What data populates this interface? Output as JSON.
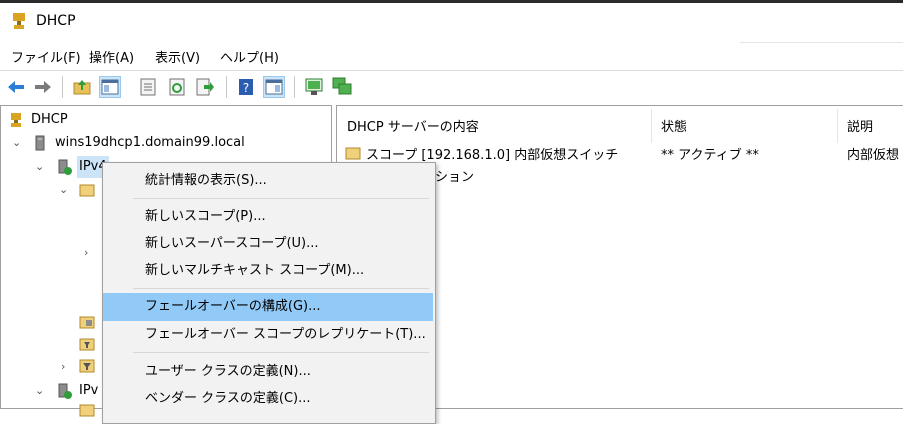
{
  "window": {
    "title": "DHCP"
  },
  "menu": [
    "ファイル(F)",
    "操作(A)",
    "表示(V)",
    "ヘルプ(H)"
  ],
  "toolbar": [
    "back-icon",
    "forward-icon",
    "up-folder-icon",
    "show-hide-tree-icon",
    "properties-icon",
    "refresh-icon",
    "export-icon",
    "help-icon",
    "action-pane-icon",
    "server-icon",
    "add-server-icon"
  ],
  "tree": {
    "root": "DHCP",
    "server": "wins19dhcp1.domain99.local",
    "ipv4": "IPv4",
    "ipv6": "IPv"
  },
  "list": {
    "columns": [
      "DHCP サーバーの内容",
      "状態",
      "説明"
    ],
    "rows": [
      {
        "name": "スコープ [192.168.1.0] 内部仮想スイッチ",
        "status": "** アクティブ **",
        "desc": "内部仮想"
      },
      {
        "name": "ション",
        "status": "",
        "desc": ""
      }
    ]
  },
  "context_menu": {
    "items": [
      "統計情報の表示(S)...",
      "新しいスコープ(P)...",
      "新しいスーパースコープ(U)...",
      "新しいマルチキャスト スコープ(M)...",
      "フェールオーバーの構成(G)...",
      "フェールオーバー スコープのレプリケート(T)...",
      "ユーザー クラスの定義(N)...",
      "ベンダー クラスの定義(C)..."
    ],
    "highlighted": "フェールオーバーの構成(G)..."
  },
  "colors": {
    "highlight": "#91c9f7",
    "selection": "#cce4f7"
  }
}
